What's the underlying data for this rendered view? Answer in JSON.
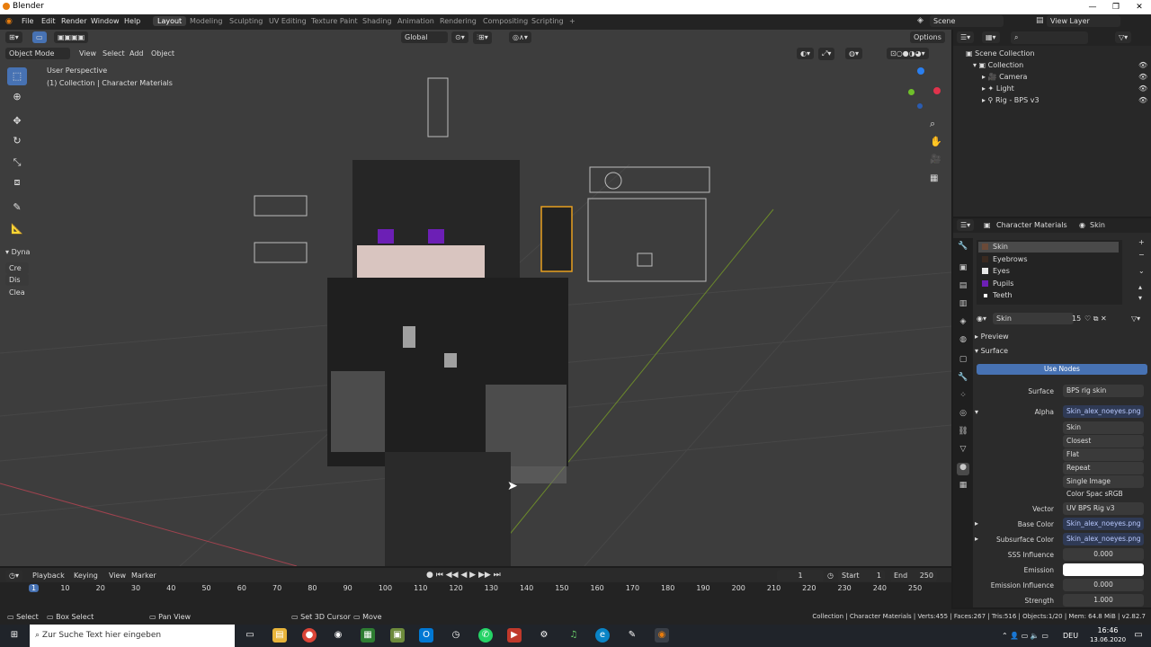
{
  "window": {
    "title": "Blender",
    "controls": [
      "—",
      "❐",
      "✕"
    ]
  },
  "menu": [
    "File",
    "Edit",
    "Render",
    "Window",
    "Help"
  ],
  "workspaces": [
    "Layout",
    "Modeling",
    "Sculpting",
    "UV Editing",
    "Texture Paint",
    "Shading",
    "Animation",
    "Rendering",
    "Compositing",
    "Scripting"
  ],
  "topright": {
    "scene": "Scene",
    "view_layer": "View Layer"
  },
  "viewport": {
    "transform": "Global",
    "options": "Options",
    "mode": "Object Mode",
    "menus": [
      "View",
      "Select",
      "Add",
      "Object"
    ],
    "overlay_line1": "User Perspective",
    "overlay_line2": "(1) Collection | Character Materials",
    "side_panel_title": "Dyna",
    "side_panel_items": [
      "Cre",
      "Dis",
      "Clea"
    ]
  },
  "outliner": {
    "root": "Scene Collection",
    "items": [
      "Collection",
      "Camera",
      "Light",
      "Rig - BPS v3"
    ]
  },
  "properties": {
    "object": "Character Materials",
    "material_tab": "Skin",
    "slots": [
      "Skin",
      "Eyebrows",
      "Eyes",
      "Pupils",
      "Teeth"
    ],
    "slot_colors": [
      "#6b4a38",
      "#3a2a20",
      "#e8e8e8",
      "#6c1fb5",
      "#ffffff"
    ],
    "material_name": "Skin",
    "users": "15",
    "preview": "Preview",
    "surface": "Surface",
    "use_nodes": "Use Nodes",
    "rows": [
      {
        "label": "Surface",
        "value": "BPS rig skin",
        "tex": false
      },
      {
        "label": "Alpha",
        "value": "Skin_alex_noeyes.png",
        "tex": true
      },
      {
        "label": "",
        "value": "Skin",
        "tex": false
      },
      {
        "label": "",
        "value": "Closest",
        "tex": false
      },
      {
        "label": "",
        "value": "Flat",
        "tex": false
      },
      {
        "label": "",
        "value": "Repeat",
        "tex": false
      },
      {
        "label": "",
        "value": "Single Image",
        "tex": false
      },
      {
        "label": "",
        "value": "Color Spac   sRGB",
        "tex": false
      },
      {
        "label": "Vector",
        "value": "UV BPS Rig v3",
        "tex": false
      },
      {
        "label": "Base Color",
        "value": "Skin_alex_noeyes.png",
        "tex": true
      },
      {
        "label": "Subsurface Color",
        "value": "Skin_alex_noeyes.png",
        "tex": true
      },
      {
        "label": "SSS Influence",
        "value": "0.000",
        "tex": false
      },
      {
        "label": "Emission",
        "value": "",
        "tex": false
      },
      {
        "label": "Emission Influence",
        "value": "0.000",
        "tex": false
      },
      {
        "label": "Strength",
        "value": "1.000",
        "tex": false
      }
    ]
  },
  "timeline": {
    "menus": [
      "Playback",
      "Keying",
      "View",
      "Marker"
    ],
    "current_frame": "1",
    "start_label": "Start",
    "start": "1",
    "end_label": "End",
    "end": "250",
    "ticks": [
      "1",
      "10",
      "20",
      "30",
      "40",
      "50",
      "60",
      "70",
      "80",
      "90",
      "100",
      "110",
      "120",
      "130",
      "140",
      "150",
      "160",
      "170",
      "180",
      "190",
      "200",
      "210",
      "220",
      "230",
      "240",
      "250"
    ]
  },
  "status": {
    "select": "Select",
    "box_select": "Box Select",
    "pan_view": "Pan View",
    "cursor": "Set 3D Cursor",
    "move": "Move",
    "stats": "Collection | Character Materials | Verts:455 | Faces:267 | Tris:516 | Objects:1/20 | Mem: 64.8 MiB | v2.82.7"
  },
  "taskbar": {
    "search_placeholder": "Zur Suche Text hier eingeben",
    "lang": "DEU",
    "time": "16:46",
    "date": "13.06.2020"
  }
}
